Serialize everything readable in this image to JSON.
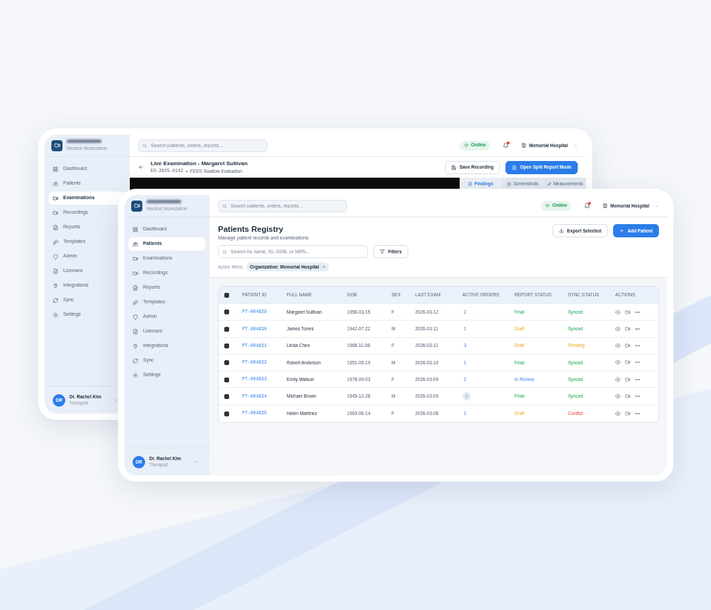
{
  "back_window": {
    "app_subtitle": "Medical Workstation",
    "search": {
      "placeholder": "Search patients, orders, reports..."
    },
    "connection": "Online",
    "hospital": "Memorial Hospital",
    "nav": [
      {
        "label": "Dashboard",
        "selected": false
      },
      {
        "label": "Patients",
        "selected": false
      },
      {
        "label": "Examinations",
        "selected": true
      },
      {
        "label": "Recordings",
        "selected": false
      },
      {
        "label": "Reports",
        "selected": false
      },
      {
        "label": "Templates",
        "selected": false
      },
      {
        "label": "Admin",
        "selected": false
      },
      {
        "label": "Licenses",
        "selected": false
      },
      {
        "label": "Integrations",
        "selected": false
      },
      {
        "label": "Sync",
        "selected": false
      },
      {
        "label": "Settings",
        "selected": false
      }
    ],
    "user": {
      "initials": "DR",
      "name": "Dr. Rachel Kim",
      "role": "Therapist"
    },
    "page_title": "Live Examination - Margaret Sullivan",
    "exam_id": "EO-2025-0142",
    "separator": "•",
    "exam_type": "FEES Swallow Evaluation",
    "buttons": [
      {
        "label": "Save Recording",
        "kind": "secondary"
      },
      {
        "label": "Open Split Report Mode",
        "kind": "primary"
      }
    ],
    "tabs": [
      {
        "label": "Findings",
        "selected": true
      },
      {
        "label": "Screenshots",
        "selected": false
      },
      {
        "label": "Measurements",
        "selected": false
      }
    ]
  },
  "front_window": {
    "app_subtitle": "Medical Workstation",
    "search": {
      "placeholder": "Search patients, orders, reports..."
    },
    "connection": "Online",
    "hospital": "Memorial Hospital",
    "nav": [
      {
        "label": "Dashboard",
        "selected": false
      },
      {
        "label": "Patients",
        "selected": true
      },
      {
        "label": "Examinations",
        "selected": false
      },
      {
        "label": "Recordings",
        "selected": false
      },
      {
        "label": "Reports",
        "selected": false
      },
      {
        "label": "Templates",
        "selected": false
      },
      {
        "label": "Admin",
        "selected": false
      },
      {
        "label": "Licenses",
        "selected": false
      },
      {
        "label": "Integrations",
        "selected": false
      },
      {
        "label": "Sync",
        "selected": false
      },
      {
        "label": "Settings",
        "selected": false
      }
    ],
    "user": {
      "initials": "DR",
      "name": "Dr. Rachel Kim",
      "role": "Therapist"
    },
    "page_title": "Patients Registry",
    "page_subtitle": "Manage patient records and examinations",
    "buttons": [
      {
        "label": "Export Selected",
        "kind": "secondary"
      },
      {
        "label": "Add Patient",
        "kind": "primary"
      }
    ],
    "table_search": {
      "placeholder": "Search by name, ID, DOB, or MRN..."
    },
    "filters_button": "Filters",
    "active_filters_label": "Active filters:",
    "filter_chips": [
      "Organization: Memorial Hospital"
    ],
    "table": {
      "select_all": {
        "checked": true
      },
      "columns": [
        "PATIENT ID",
        "FULL NAME",
        "DOB",
        "SEX",
        "LAST EXAM",
        "ACTIVE ORDERS",
        "REPORT STATUS",
        "SYNC STATUS",
        "ACTIONS"
      ],
      "rows": [
        {
          "checked": true,
          "id": "PT-004829",
          "name": "Margaret Sullivan",
          "dob": "1956-03-15",
          "sex": "F",
          "last_exam": "2026-03-12",
          "orders": "2",
          "orders_pill": false,
          "report": {
            "text": "Final",
            "kind": "final"
          },
          "sync": {
            "text": "Synced",
            "kind": "synced"
          }
        },
        {
          "checked": true,
          "id": "PT-004830",
          "name": "James Torres",
          "dob": "1942-07-22",
          "sex": "M",
          "last_exam": "2026-03-11",
          "orders": "1",
          "orders_pill": false,
          "report": {
            "text": "Draft",
            "kind": "draft"
          },
          "sync": {
            "text": "Synced",
            "kind": "synced"
          }
        },
        {
          "checked": true,
          "id": "PT-004831",
          "name": "Linda Chen",
          "dob": "1968-11-08",
          "sex": "F",
          "last_exam": "2026-03-11",
          "orders": "3",
          "orders_pill": false,
          "report": {
            "text": "Draft",
            "kind": "draft"
          },
          "sync": {
            "text": "Pending",
            "kind": "pending"
          }
        },
        {
          "checked": true,
          "id": "PT-004832",
          "name": "Robert Anderson",
          "dob": "1951-05-19",
          "sex": "M",
          "last_exam": "2026-03-10",
          "orders": "1",
          "orders_pill": false,
          "report": {
            "text": "Final",
            "kind": "final"
          },
          "sync": {
            "text": "Synced",
            "kind": "synced"
          }
        },
        {
          "checked": true,
          "id": "PT-004833",
          "name": "Emily Watson",
          "dob": "1978-09-03",
          "sex": "F",
          "last_exam": "2026-03-09",
          "orders": "2",
          "orders_pill": false,
          "report": {
            "text": "In Review",
            "kind": "review"
          },
          "sync": {
            "text": "Synced",
            "kind": "synced"
          }
        },
        {
          "checked": true,
          "id": "PT-004834",
          "name": "Michael Brown",
          "dob": "1945-12-28",
          "sex": "M",
          "last_exam": "2026-03-09",
          "orders": "0",
          "orders_pill": true,
          "report": {
            "text": "Final",
            "kind": "final"
          },
          "sync": {
            "text": "Synced",
            "kind": "synced"
          }
        },
        {
          "checked": true,
          "id": "PT-004835",
          "name": "Helen Martinez",
          "dob": "1963-06-14",
          "sex": "F",
          "last_exam": "2026-03-08",
          "orders": "1",
          "orders_pill": false,
          "report": {
            "text": "Draft",
            "kind": "draft"
          },
          "sync": {
            "text": "Conflict",
            "kind": "conflict"
          }
        }
      ]
    }
  }
}
